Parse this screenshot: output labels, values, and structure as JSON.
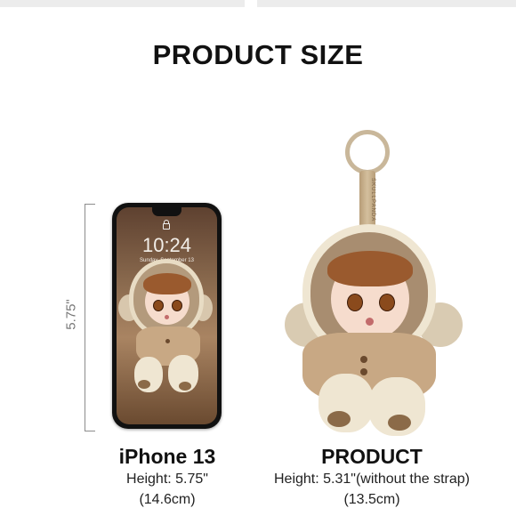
{
  "title": "PRODUCT SIZE",
  "dimension_label": "5.75\"",
  "phone": {
    "clock": "10:24",
    "date": "Sunday, September 13",
    "name": "iPhone 13",
    "height_text": "Height: 5.75\"",
    "metric_text": "(14.6cm)"
  },
  "product": {
    "strap_text": "SKULLPANDA",
    "name": "PRODUCT",
    "height_text": "Height: 5.31\"(without the strap)",
    "metric_text": "(13.5cm)"
  },
  "icons": [
    "lock-icon"
  ],
  "colors": {
    "hood_fleece": "#efe6d2",
    "coat": "#c8a884",
    "ring": "#c9b79a"
  }
}
